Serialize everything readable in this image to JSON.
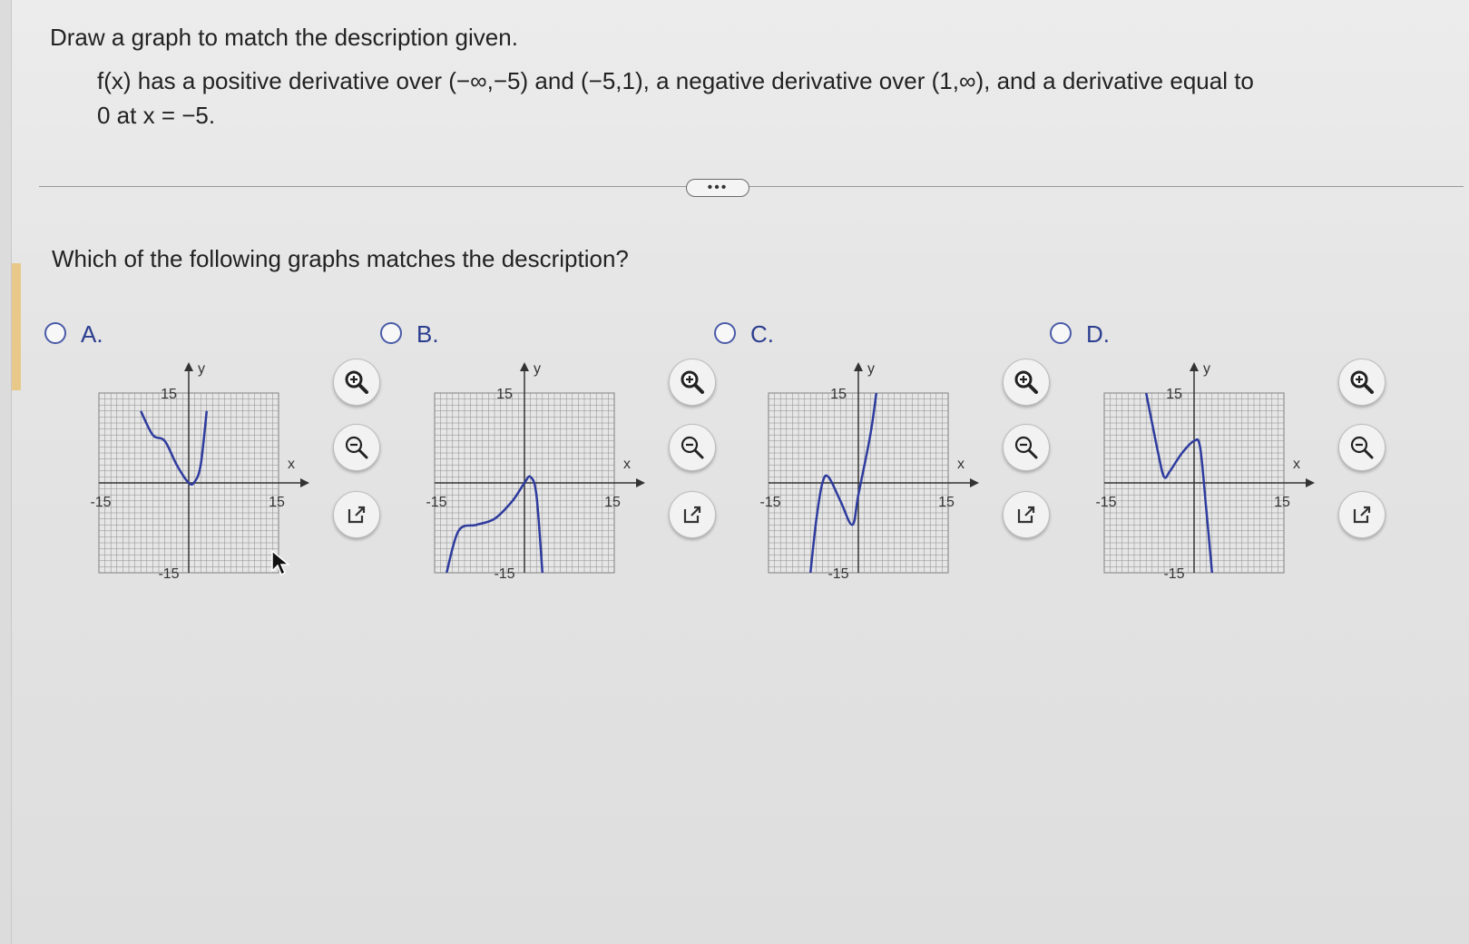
{
  "prompt": {
    "title": "Draw a graph to match the description given.",
    "line1": "f(x) has a positive derivative over (−∞,−5) and (−5,1), a negative derivative over (1,∞), and a derivative equal to",
    "line2": "0 at x = −5."
  },
  "more_label": "•••",
  "question": "Which of the following graphs matches the description?",
  "axis": {
    "x_label": "x",
    "y_label": "y",
    "xlim": [
      -15,
      15
    ],
    "ylim": [
      -15,
      15
    ],
    "min_label": "-15",
    "max_label": "15"
  },
  "options": [
    {
      "letter": "A.",
      "curve_color": "#2e3b9e",
      "points": [
        [
          -8,
          12
        ],
        [
          -6,
          8
        ],
        [
          -4,
          7
        ],
        [
          -2,
          3
        ],
        [
          0,
          0
        ],
        [
          1,
          0.2
        ],
        [
          2,
          3
        ],
        [
          3,
          12
        ]
      ]
    },
    {
      "letter": "B.",
      "curve_color": "#2e3b9e",
      "points": [
        [
          -13,
          -15
        ],
        [
          -11,
          -8
        ],
        [
          -8,
          -7
        ],
        [
          -5,
          -6
        ],
        [
          -2,
          -3
        ],
        [
          0,
          0
        ],
        [
          1,
          1
        ],
        [
          2,
          -2
        ],
        [
          3,
          -15
        ]
      ]
    },
    {
      "letter": "C.",
      "curve_color": "#2e3b9e",
      "points": [
        [
          -8,
          -15
        ],
        [
          -7,
          -6
        ],
        [
          -6,
          0
        ],
        [
          -5,
          1
        ],
        [
          -3,
          -3
        ],
        [
          -1,
          -7
        ],
        [
          0,
          -2
        ],
        [
          2,
          8
        ],
        [
          3,
          15
        ]
      ]
    },
    {
      "letter": "D.",
      "curve_color": "#2e3b9e",
      "points": [
        [
          -8,
          15
        ],
        [
          -6,
          5
        ],
        [
          -5,
          1
        ],
        [
          -4,
          2
        ],
        [
          -2,
          5
        ],
        [
          0,
          7
        ],
        [
          1,
          6
        ],
        [
          2,
          -4
        ],
        [
          3,
          -15
        ]
      ]
    }
  ],
  "tools": {
    "zoom_in": "zoom-in-icon",
    "zoom_out": "zoom-out-icon",
    "popout": "external-link-icon"
  }
}
